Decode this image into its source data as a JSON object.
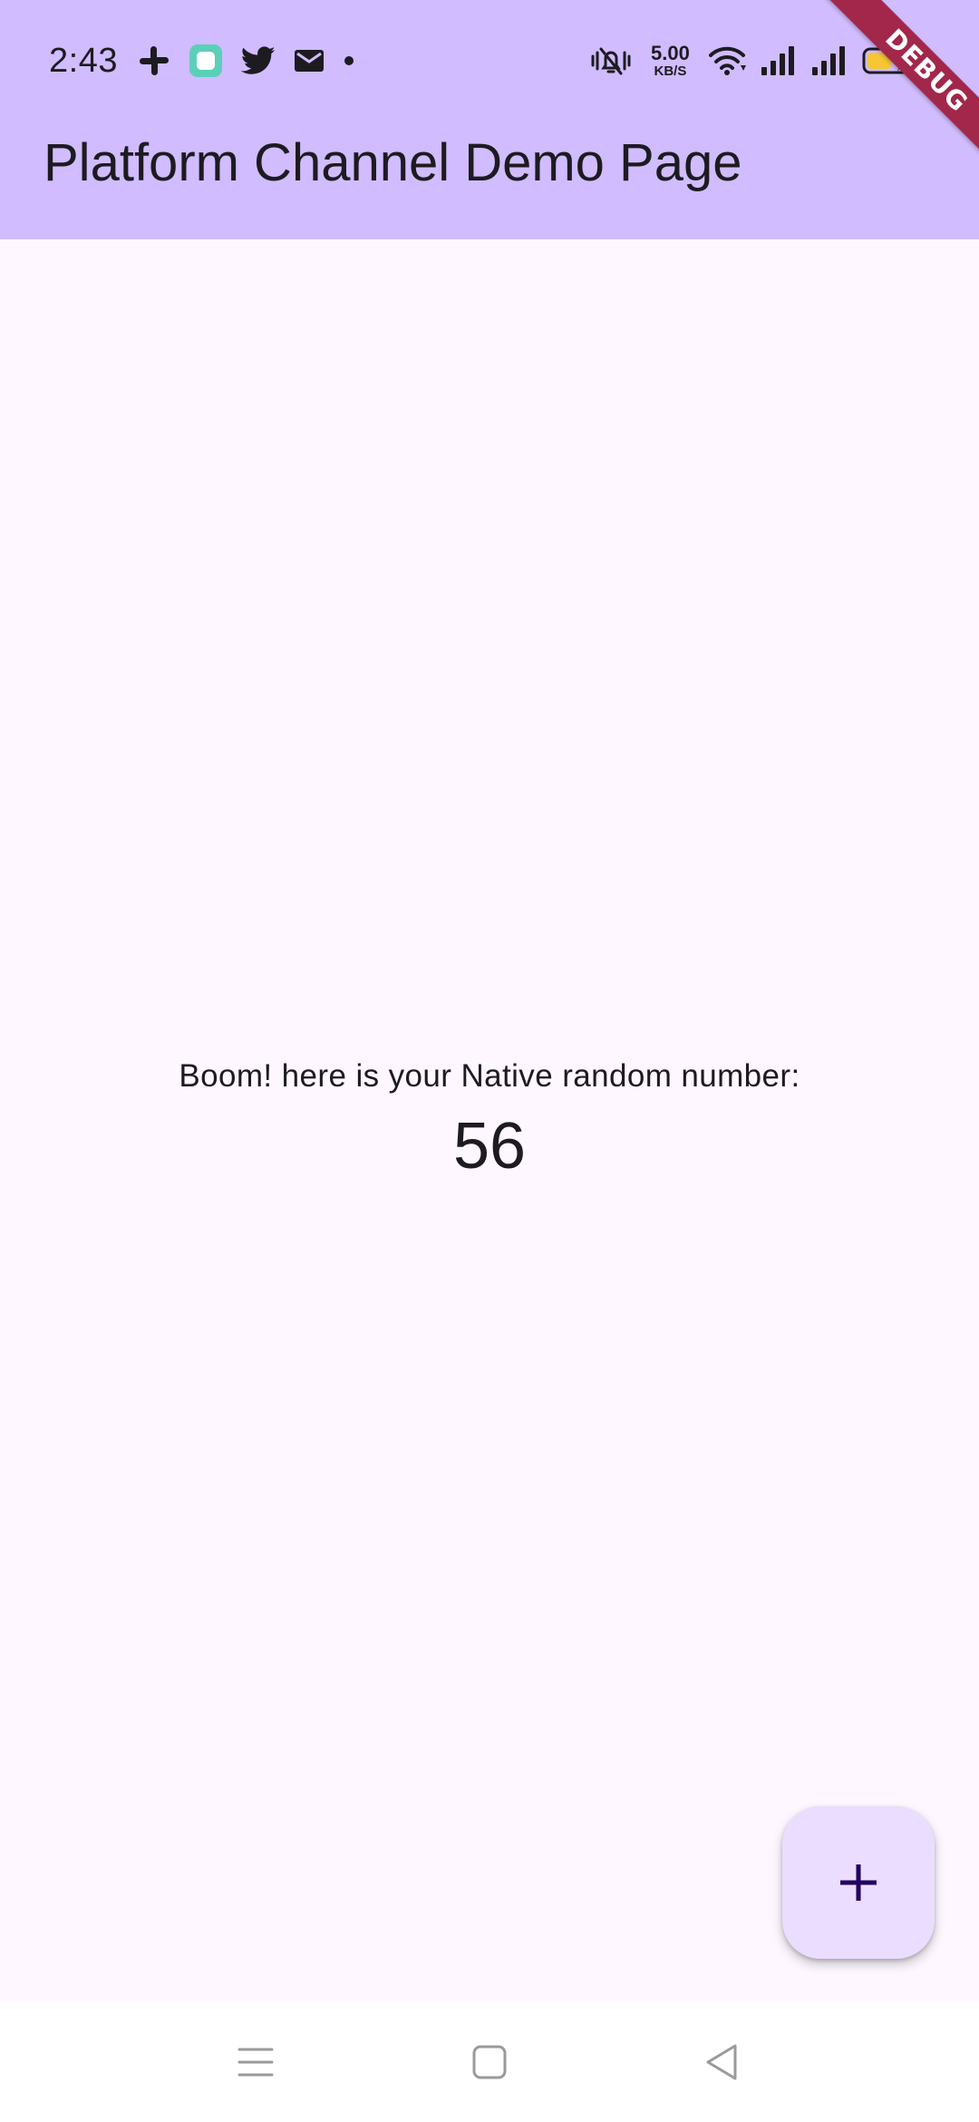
{
  "status_bar": {
    "time": "2:43",
    "notification_icons": [
      "slack-icon",
      "app-notification-icon",
      "twitter-icon",
      "mail-icon",
      "more-dot-icon"
    ],
    "network_speed_value": "5.00",
    "network_speed_unit": "KB/S",
    "system_icons": [
      "vibrate-silent-icon",
      "wifi-icon",
      "signal-sim1-icon",
      "signal-sim2-icon",
      "battery-charging-icon"
    ]
  },
  "app_bar": {
    "title": "Platform Channel Demo Page"
  },
  "debug_banner": "DEBUG",
  "main": {
    "message": "Boom! here is your Native random number:",
    "number": "56"
  },
  "fab": {
    "icon": "add-icon"
  },
  "nav_bar": {
    "buttons": [
      "menu-icon",
      "home-icon",
      "back-icon"
    ]
  },
  "colors": {
    "app_bar": "#d0bcff",
    "background": "#fef7ff",
    "fab": "#eaddff",
    "fab_icon": "#21005d",
    "debug_banner": "#a3264b",
    "text": "#1d1b20"
  }
}
